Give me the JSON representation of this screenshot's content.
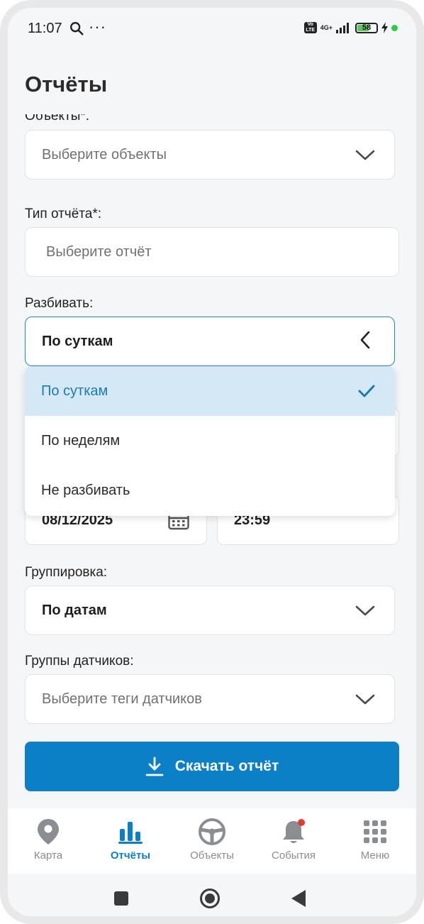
{
  "status_bar": {
    "time": "11:07",
    "network": "4G+",
    "volte": "Vo LTE",
    "battery_level": "58"
  },
  "page": {
    "title": "Отчёты"
  },
  "form": {
    "objects": {
      "label": "Объекты*:",
      "placeholder": "Выберите объекты"
    },
    "report_type": {
      "label": "Тип отчёта*:",
      "placeholder": "Выберите отчёт"
    },
    "split": {
      "label": "Разбивать:",
      "value": "По суткам",
      "options": [
        "По суткам",
        "По неделям",
        "Не разбивать"
      ],
      "selected_index": 0
    },
    "end_date": {
      "date": "08/12/2025",
      "time": "23:59"
    },
    "grouping": {
      "label": "Группировка:",
      "value": "По датам"
    },
    "sensor_groups": {
      "label": "Группы датчиков:",
      "placeholder": "Выберите теги датчиков"
    },
    "download_label": "Скачать отчёт"
  },
  "tabbar": {
    "items": [
      {
        "label": "Карта",
        "icon": "map-pin-icon"
      },
      {
        "label": "Отчёты",
        "icon": "bar-chart-icon",
        "active": true
      },
      {
        "label": "Объекты",
        "icon": "steering-wheel-icon"
      },
      {
        "label": "События",
        "icon": "bell-icon",
        "badge": true
      },
      {
        "label": "Меню",
        "icon": "grid-icon"
      }
    ]
  },
  "colors": {
    "accent": "#0b80c6",
    "selected_bg": "#d4e9f5",
    "badge": "#e53935",
    "background": "#f5f6f7"
  }
}
